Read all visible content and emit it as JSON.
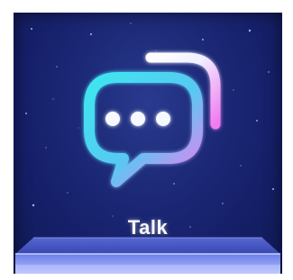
{
  "app": {
    "label": "Talk",
    "icon": "chat-bubble-icon"
  },
  "colors": {
    "background": "#1d2a78",
    "icon_gradient_start": "#3ee6f0",
    "icon_gradient_end": "#f07cf0",
    "label": "#f4f6ff"
  }
}
